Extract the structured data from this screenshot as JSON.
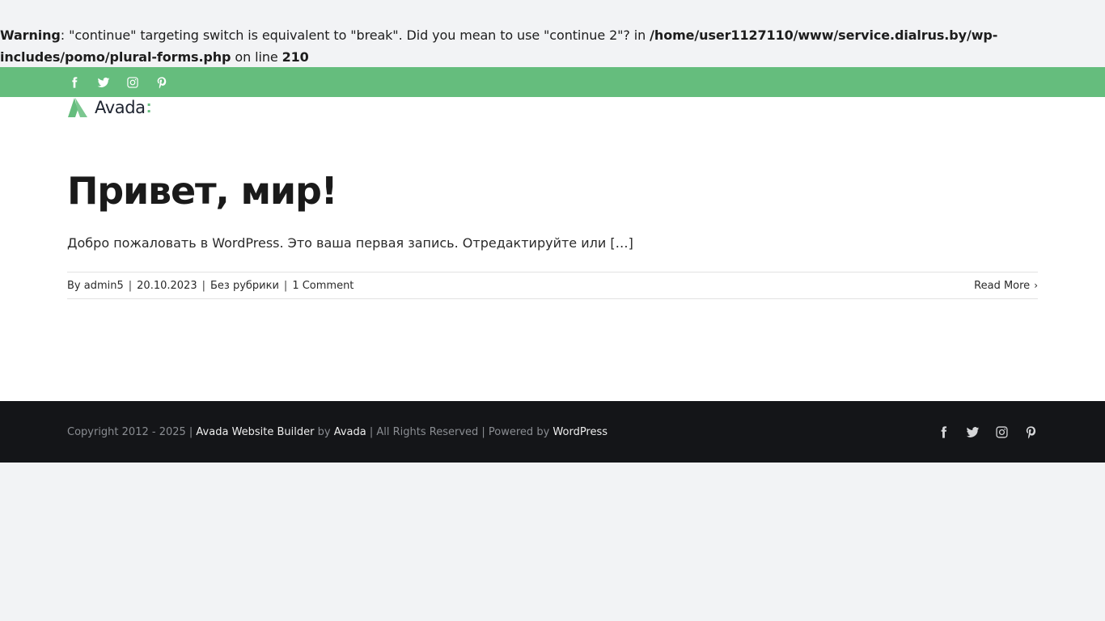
{
  "warning": {
    "label": "Warning",
    "message": ": \"continue\" targeting switch is equivalent to \"break\". Did you mean to use \"continue 2\"? in ",
    "path": "/home/user1127110/www/service.dialrus.by/wp-includes/pomo/plural-forms.php",
    "on_line_text": " on line ",
    "line": "210"
  },
  "top_bar": {
    "color": "#65bd7d",
    "social_icons": [
      "facebook-icon",
      "twitter-icon",
      "instagram-icon",
      "pinterest-icon"
    ]
  },
  "logo": {
    "text": "Avada",
    "colon": ":",
    "accent": "#65bd7d"
  },
  "post": {
    "title": "Привет, мир!",
    "excerpt": "Добро пожаловать в WordPress. Это ваша первая запись. Отредактируйте или […]",
    "meta": {
      "by": "By ",
      "author": "admin5",
      "date": "20.10.2023",
      "category": "Без рубрики",
      "comments": "1 Comment",
      "separator": "|"
    },
    "read_more": "Read More",
    "read_more_icon": "chevron-right-icon"
  },
  "footer": {
    "copyright_prefix": "Copyright 2012 - 2025 | ",
    "builder_link": "Avada Website Builder",
    "by": " by ",
    "avada_link": "Avada",
    "rights": " | All Rights Reserved | Powered by ",
    "wordpress_link": "WordPress",
    "social_icons": [
      "facebook-icon",
      "twitter-icon",
      "instagram-icon",
      "pinterest-icon"
    ]
  }
}
